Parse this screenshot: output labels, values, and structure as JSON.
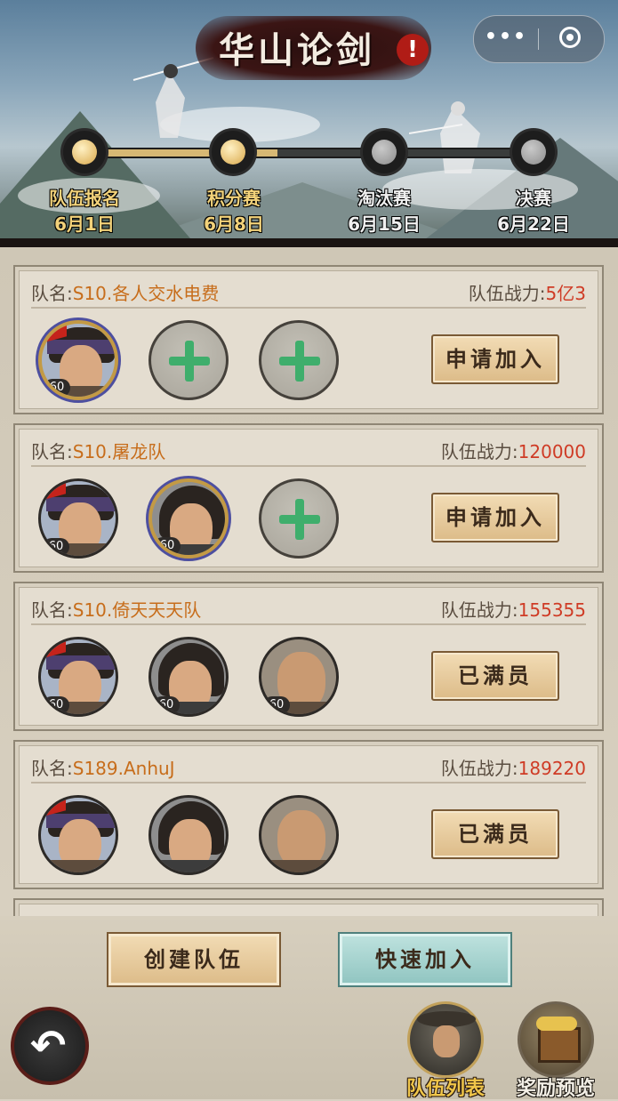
{
  "header": {
    "title": "华山论剑",
    "title_mark": "!",
    "capsule": {
      "more_icon": "•••",
      "close_icon": "target-circle"
    }
  },
  "stages": [
    {
      "name": "队伍报名",
      "date": "6月1日",
      "state": "active"
    },
    {
      "name": "积分赛",
      "date": "6月8日",
      "state": "active"
    },
    {
      "name": "淘汰赛",
      "date": "6月15日",
      "state": "upcoming"
    },
    {
      "name": "决赛",
      "date": "6月22日",
      "state": "upcoming"
    }
  ],
  "progress_fraction": 0.43,
  "labels": {
    "team_name_prefix": "队名:",
    "power_prefix": "队伍战力:"
  },
  "teams": [
    {
      "name": "S10.各人交水电费",
      "power": "5亿3",
      "action": "申请加入",
      "members": [
        {
          "type": "hero-flag",
          "level": "60"
        },
        {
          "type": "empty"
        },
        {
          "type": "empty"
        }
      ]
    },
    {
      "name": "S10.屠龙队",
      "power": "120000",
      "action": "申请加入",
      "members": [
        {
          "type": "hero-flag",
          "level": "60"
        },
        {
          "type": "hero-long-hair",
          "level": "60"
        },
        {
          "type": "empty"
        }
      ]
    },
    {
      "name": "S10.倚天天天队",
      "power": "155355",
      "action": "已满员",
      "members": [
        {
          "type": "hero-flag",
          "level": "60"
        },
        {
          "type": "hero-long-hair",
          "level": "60"
        },
        {
          "type": "hero-bald",
          "level": "60"
        }
      ]
    },
    {
      "name": "S189.AnhuJ",
      "power": "189220",
      "action": "已满员",
      "members": [
        {
          "type": "hero-flag",
          "level": ""
        },
        {
          "type": "hero-long-hair",
          "level": ""
        },
        {
          "type": "hero-bald",
          "level": ""
        }
      ]
    }
  ],
  "footer": {
    "create_label": "创建队伍",
    "quick_join_label": "快速加入",
    "nav": [
      {
        "label": "队伍列表",
        "icon": "swordsman-icon",
        "active": true
      },
      {
        "label": "奖励预览",
        "icon": "treasure-chest-icon",
        "active": false
      }
    ],
    "back_icon": "↶"
  },
  "colors": {
    "team_name": "#c76d1b",
    "power_value": "#cf3b25",
    "join_button": "#dcbb88",
    "quick_join_button": "#8fc4c0",
    "plus_green": "#3fae6c"
  }
}
